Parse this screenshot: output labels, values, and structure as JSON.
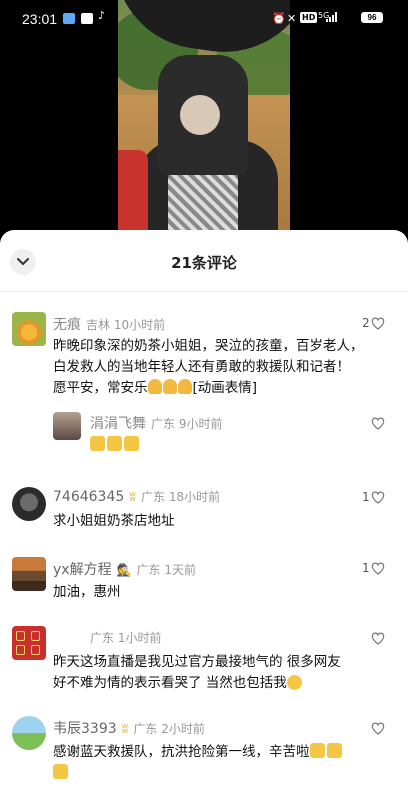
{
  "status": {
    "time": "23:01",
    "battery": "96",
    "network": "5G",
    "hd": "HD"
  },
  "sheet": {
    "title": "21条评论"
  },
  "comments": [
    {
      "user": "无痕",
      "location": "吉林",
      "time": "10小时前",
      "likes": "2",
      "lines": [
        "昨晚印象深的奶茶小姐姐，哭泣的孩童，百岁老人，",
        "白发救人的当地年轻人还有勇敢的救援队和记者！",
        "愿平安，常安乐",
        "[动画表情]"
      ]
    },
    {
      "user": "涓涓飞舞",
      "location": "广东",
      "time": "9小时前",
      "likes": ""
    },
    {
      "user": "74646345",
      "location": "广东",
      "time": "18小时前",
      "likes": "1",
      "text": "求小姐姐奶茶店地址"
    },
    {
      "user": "yx解方程",
      "location": "广东",
      "time": "1天前",
      "likes": "1",
      "text": "加油，惠州"
    },
    {
      "user": "",
      "location": "广东",
      "time": "1小时前",
      "likes": "",
      "lines": [
        "昨天这场直播是我见过官方最接地气的  很多网友",
        "好不难为情的表示看哭了 当然也包括我"
      ]
    },
    {
      "user": "韦辰3393",
      "location": "广东",
      "time": "2小时前",
      "likes": "",
      "text": "感谢蓝天救援队，抗洪抢险第一线，辛苦啦"
    }
  ],
  "icons": {
    "collapse": "chevron-down-icon",
    "like": "heart-outline-icon",
    "badge": "wheat-badge-icon"
  },
  "colors": {
    "accent_badge": "#e2b33f",
    "meta_text": "#999999"
  }
}
